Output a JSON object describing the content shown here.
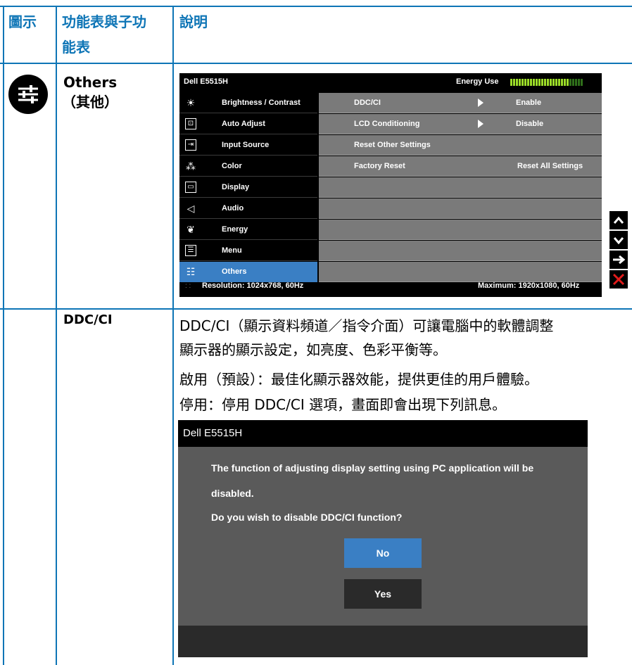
{
  "header": {
    "col_icon": "圖示",
    "col_menu_line1": "功能表與子功",
    "col_menu_line2": "能表",
    "col_desc": "說明"
  },
  "row_others": {
    "name": "Others",
    "name_zh": "（其他）"
  },
  "osd": {
    "title": "Dell E5515H",
    "energy_label": "Energy Use",
    "energy_level": 0.8,
    "menu_items": [
      {
        "label": "Brightness / Contrast",
        "icon": "brightness-icon"
      },
      {
        "label": "Auto Adjust",
        "icon": "auto-adjust-icon"
      },
      {
        "label": "Input Source",
        "icon": "input-source-icon"
      },
      {
        "label": "Color",
        "icon": "color-icon"
      },
      {
        "label": "Display",
        "icon": "display-icon"
      },
      {
        "label": "Audio",
        "icon": "audio-icon"
      },
      {
        "label": "Energy",
        "icon": "energy-icon"
      },
      {
        "label": "Menu",
        "icon": "menu-icon"
      },
      {
        "label": "Others",
        "icon": "others-icon",
        "active": true
      }
    ],
    "sub_items": [
      {
        "label": "DDC/CI",
        "arrow": true,
        "value": "Enable"
      },
      {
        "label": "LCD Conditioning",
        "arrow": true,
        "value": "Disable"
      },
      {
        "label": "Reset Other Settings",
        "arrow": false,
        "value": ""
      },
      {
        "label": "Factory Reset",
        "arrow": false,
        "value": "Reset All Settings"
      }
    ],
    "footer_left": "Resolution: 1024x768, 60Hz",
    "footer_right": "Maximum: 1920x1080, 60Hz",
    "side_buttons": [
      "up-icon",
      "down-icon",
      "enter-icon",
      "close-icon"
    ]
  },
  "row_ddcci": {
    "name": "DDC/CI",
    "desc_line1": "DDC/CI（顯示資料頻道／指令介面）可讓電腦中的軟體調整",
    "desc_line2": "顯示器的顯示設定，如亮度、色彩平衡等。",
    "desc_line3": "啟用（預設）：最佳化顯示器效能，提供更佳的用戶體驗。",
    "desc_line4": "停用：停用 DDC/CI 選項，畫面即會出現下列訊息。"
  },
  "dialog": {
    "title": "Dell E5515H",
    "line1": "The function of adjusting display setting using PC application will be",
    "line2": "disabled.",
    "line3": "Do you wish to disable DDC/CI function?",
    "no_label": "No",
    "yes_label": "Yes"
  }
}
